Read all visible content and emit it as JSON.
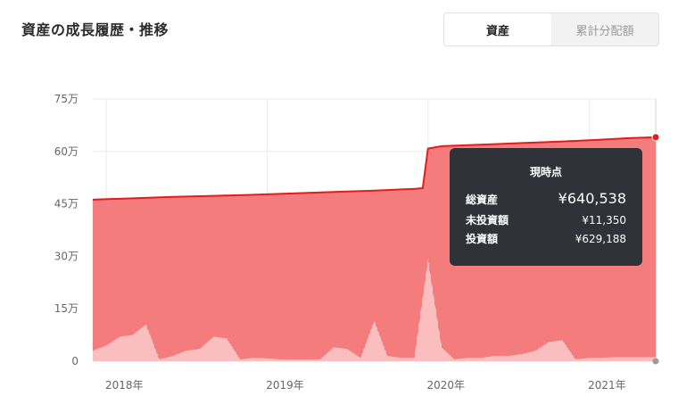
{
  "header": {
    "title": "資産の成長履歴・推移"
  },
  "toggle": {
    "asset_label": "資産",
    "dividend_label": "累計分配額"
  },
  "tooltip": {
    "title": "現時点",
    "rows": [
      {
        "label": "総資産",
        "value": "¥640,538"
      },
      {
        "label": "未投資額",
        "value": "¥11,350"
      },
      {
        "label": "投資額",
        "value": "¥629,188"
      }
    ]
  },
  "colors": {
    "area_fill": "#f47c7c",
    "line": "#e01e1e",
    "marker": "#e01e1e",
    "bars": "#ffffff"
  },
  "chart_data": {
    "type": "area",
    "title": "資産の成長履歴・推移",
    "y_ticks": [
      "0",
      "15万",
      "30万",
      "45万",
      "60万",
      "75万"
    ],
    "y_tick_values": [
      0,
      150000,
      300000,
      450000,
      600000,
      750000
    ],
    "ylim": [
      0,
      750000
    ],
    "x_ticks": [
      "2018年",
      "2019年",
      "2020年",
      "2021年"
    ],
    "x_tick_values": [
      "2018-01",
      "2019-01",
      "2020-01",
      "2021-01"
    ],
    "xlim": [
      "2017-12",
      "2021-06"
    ],
    "grid": true,
    "series": [
      {
        "kind": "area-line",
        "x": [
          "2017-12",
          "2018-03",
          "2018-06",
          "2018-09",
          "2018-12",
          "2019-03",
          "2019-06",
          "2019-09",
          "2019-12",
          "2019-12-20",
          "2020-01",
          "2020-02",
          "2020-04",
          "2020-06",
          "2020-08",
          "2020-10",
          "2020-12",
          "2021-02",
          "2021-04",
          "2021-06"
        ],
        "y": [
          462000,
          466000,
          470000,
          473000,
          476000,
          480000,
          484000,
          488000,
          493000,
          495000,
          608000,
          615000,
          618000,
          621000,
          624000,
          627000,
          630000,
          634000,
          638000,
          640538
        ]
      },
      {
        "kind": "uninvested-bars",
        "x": [
          "2017-12",
          "2018-01",
          "2018-02",
          "2018-03",
          "2018-04",
          "2018-05",
          "2018-06",
          "2018-07",
          "2018-08",
          "2018-09",
          "2018-10",
          "2018-11",
          "2018-12",
          "2019-01",
          "2019-02",
          "2019-03",
          "2019-04",
          "2019-05",
          "2019-06",
          "2019-07",
          "2019-08",
          "2019-09",
          "2019-10",
          "2019-11",
          "2019-12",
          "2020-01",
          "2020-02",
          "2020-03",
          "2020-04",
          "2020-05",
          "2020-06",
          "2020-07",
          "2020-08",
          "2020-09",
          "2020-10",
          "2020-11",
          "2020-12",
          "2021-01",
          "2021-02",
          "2021-03",
          "2021-04",
          "2021-05",
          "2021-06"
        ],
        "y": [
          30000,
          45000,
          70000,
          75000,
          105000,
          5000,
          15000,
          30000,
          35000,
          70000,
          65000,
          5000,
          10000,
          8000,
          5000,
          5000,
          5000,
          5000,
          40000,
          35000,
          10000,
          115000,
          15000,
          10000,
          10000,
          290000,
          40000,
          5000,
          10000,
          10000,
          15000,
          15000,
          20000,
          30000,
          55000,
          60000,
          5000,
          10000,
          10000,
          11350,
          11350,
          11350,
          11350
        ]
      }
    ]
  }
}
